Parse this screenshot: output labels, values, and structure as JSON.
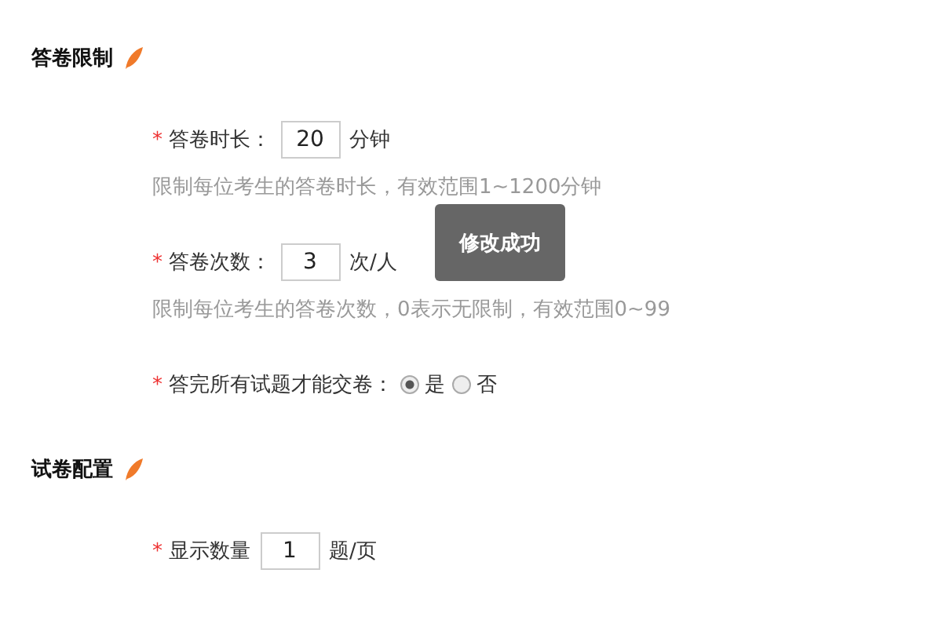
{
  "sections": [
    {
      "title": "答卷限制",
      "fields": [
        {
          "kind": "input",
          "mark": "*",
          "label": "答卷时长：",
          "value": "20",
          "unit": "分钟",
          "hint": "限制每位考生的答卷时长，有效范围1~1200分钟"
        },
        {
          "kind": "input",
          "mark": "*",
          "label": "答卷次数：",
          "value": "3",
          "unit": "次/人",
          "hint": "限制每位考生的答卷次数，0表示无限制，有效范围0~99"
        },
        {
          "kind": "radio",
          "mark": "*",
          "label": "答完所有试题才能交卷：",
          "options": [
            {
              "label": "是",
              "selected": true
            },
            {
              "label": "否",
              "selected": false
            }
          ]
        }
      ]
    },
    {
      "title": "试卷配置",
      "fields": [
        {
          "kind": "input",
          "mark": "*",
          "label": "显示数量",
          "value": "1",
          "unit": "题/页"
        }
      ]
    }
  ],
  "toast": "修改成功"
}
